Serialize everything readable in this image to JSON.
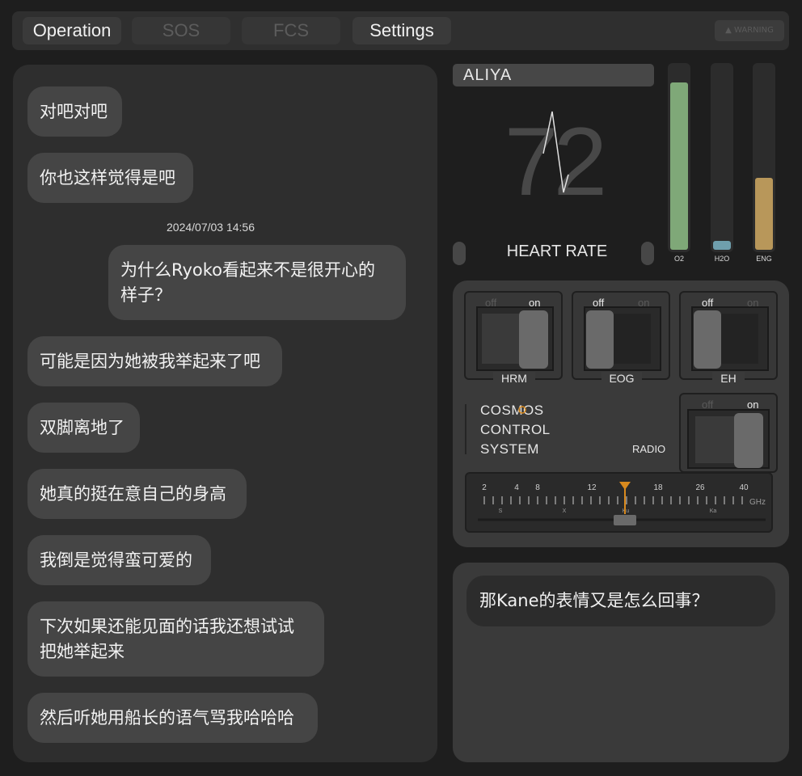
{
  "tabs": [
    {
      "label": "Operation",
      "active": true
    },
    {
      "label": "SOS",
      "active": false
    },
    {
      "label": "FCS",
      "active": false
    },
    {
      "label": "Settings",
      "active": true
    }
  ],
  "warning_badge": "WARNING",
  "chat": {
    "messages": [
      {
        "text": "对吧对吧",
        "side": "left"
      },
      {
        "text": "你也这样觉得是吧",
        "side": "left"
      },
      {
        "text": "为什么Ryoko看起来不是很开心的\n样子？",
        "side": "right"
      },
      {
        "text": "可能是因为她被我举起来了吧",
        "side": "left"
      },
      {
        "text": "双脚离地了",
        "side": "left"
      },
      {
        "text": "她真的挺在意自己的身高",
        "side": "left"
      },
      {
        "text": "我倒是觉得蛮可爱的",
        "side": "left"
      },
      {
        "text": "下次如果还能见面的话我还想试试\n把她举起来",
        "side": "left"
      },
      {
        "text": "然后听她用船长的语气骂我哈哈哈",
        "side": "left"
      }
    ],
    "timestamp": "2024/07/03  14:56"
  },
  "monitor": {
    "name": "ALIYA",
    "heart_rate": "72",
    "heart_rate_label": "HEART RATE",
    "gauges": [
      {
        "label": "O2",
        "level": 0.91,
        "color": "#7fa878"
      },
      {
        "label": "H2O",
        "level": 0.05,
        "color": "#6f9fad"
      },
      {
        "label": "ENG",
        "level": 0.39,
        "color": "#b8975a"
      }
    ]
  },
  "switches": [
    {
      "name": "HRM",
      "off_label": "off",
      "on_label": "on",
      "state": "on"
    },
    {
      "name": "EOG",
      "off_label": "off",
      "on_label": "on",
      "state": "off"
    },
    {
      "name": "EH",
      "off_label": "off",
      "on_label": "on",
      "state": "off"
    },
    {
      "name": "RADIO",
      "off_label": "off",
      "on_label": "on",
      "state": "on"
    }
  ],
  "system_name": "COSMOS\nCONTROL\nSYSTEM",
  "radio": {
    "ticks": [
      "2",
      "4",
      "8",
      "12",
      "18",
      "26",
      "40"
    ],
    "unit": "GHz",
    "bands": [
      "S",
      "X",
      "Ku",
      "Ka"
    ],
    "tuned_ghz": 15,
    "pointer_color": "#d98a1e"
  },
  "input": {
    "text": "那Kane的表情又是怎么回事？"
  }
}
